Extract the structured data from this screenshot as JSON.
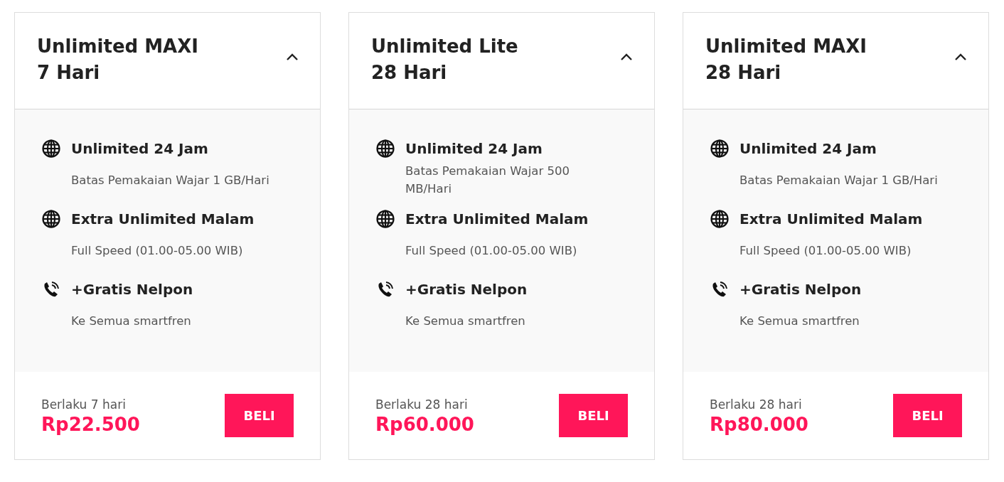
{
  "plans": [
    {
      "title_lines": [
        "Unlimited MAXI",
        "7 Hari"
      ],
      "expanded": true,
      "features": [
        {
          "kind": "internet",
          "title": "Unlimited 24 Jam",
          "description": "Batas Pemakaian Wajar 1 GB/Hari"
        },
        {
          "kind": "internet",
          "title": "Extra Unlimited Malam",
          "description": "Full Speed (01.00-05.00 WIB)"
        },
        {
          "kind": "call",
          "title": "+Gratis Nelpon",
          "description": "Ke Semua smartfren"
        }
      ],
      "validity": "Berlaku 7 hari",
      "price": "Rp22.500",
      "button": "BELI"
    },
    {
      "title_lines": [
        "Unlimited Lite",
        "28 Hari"
      ],
      "expanded": true,
      "features": [
        {
          "kind": "internet",
          "title": "Unlimited 24 Jam",
          "description": "Batas Pemakaian Wajar 500 MB/Hari"
        },
        {
          "kind": "internet",
          "title": "Extra Unlimited Malam",
          "description": "Full Speed (01.00-05.00 WIB)"
        },
        {
          "kind": "call",
          "title": "+Gratis Nelpon",
          "description": "Ke Semua smartfren"
        }
      ],
      "validity": "Berlaku 28 hari",
      "price": "Rp60.000",
      "button": "BELI"
    },
    {
      "title_lines": [
        "Unlimited MAXI",
        "28 Hari"
      ],
      "expanded": true,
      "features": [
        {
          "kind": "internet",
          "title": "Unlimited 24 Jam",
          "description": "Batas Pemakaian Wajar 1 GB/Hari"
        },
        {
          "kind": "internet",
          "title": "Extra Unlimited Malam",
          "description": "Full Speed (01.00-05.00 WIB)"
        },
        {
          "kind": "call",
          "title": "+Gratis Nelpon",
          "description": "Ke Semua smartfren"
        }
      ],
      "validity": "Berlaku 28 hari",
      "price": "Rp80.000",
      "button": "BELI"
    }
  ]
}
